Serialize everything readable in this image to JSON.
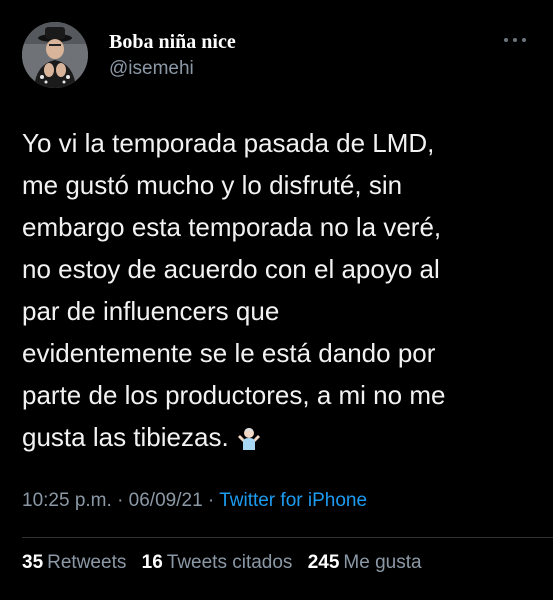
{
  "tweet": {
    "author": {
      "display_name": "Boba niña nice",
      "handle": "@isemehi",
      "avatar_icon": "profile-photo"
    },
    "more_icon": "more-options-icon",
    "text": "Yo vi la temporada pasada de LMD,\nme gustó mucho y lo disfruté, sin\nembargo esta temporada no la veré,\nno estoy de acuerdo con el apoyo al\npar de influencers que\nevidentemente se le está dando por\nparte de los productores, a mi no me\ngusta las tibiezas.",
    "emoji": "person-shrugging-emoji",
    "time": "10:25 p.m.",
    "separator": "·",
    "date": "06/09/21",
    "source": "Twitter for iPhone",
    "stats": {
      "retweets_count": "35",
      "retweets_label": "Retweets",
      "quotes_count": "16",
      "quotes_label": "Tweets citados",
      "likes_count": "245",
      "likes_label": "Me gusta"
    },
    "colors": {
      "background": "#000000",
      "link": "#1d9bf0",
      "secondary_text": "#8b98a5"
    }
  }
}
